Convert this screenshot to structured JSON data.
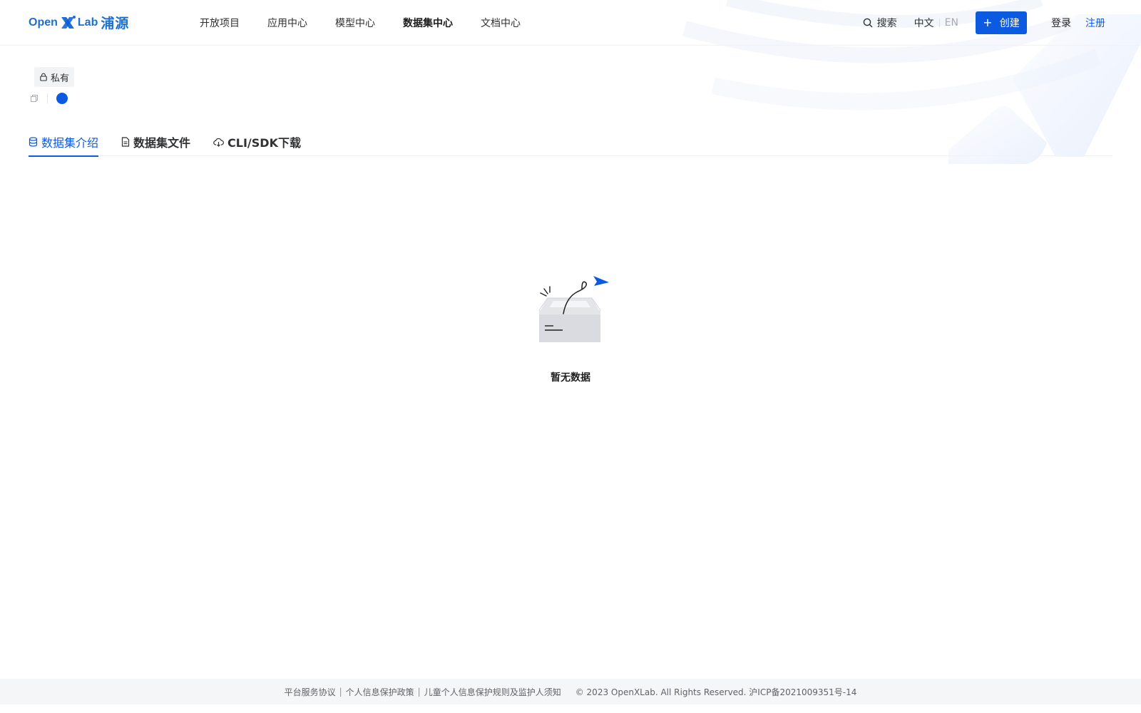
{
  "brand": {
    "logo_open": "Open",
    "logo_lab": "Lab",
    "logo_cn": "浦源",
    "accent": "#0c5ae0"
  },
  "nav": {
    "items": [
      {
        "label": "开放项目"
      },
      {
        "label": "应用中心"
      },
      {
        "label": "模型中心"
      },
      {
        "label": "数据集中心",
        "active": true
      },
      {
        "label": "文档中心"
      }
    ]
  },
  "header": {
    "search_label": "搜索",
    "search_icon": "search-icon",
    "lang_zh": "中文",
    "lang_en": "EN",
    "create_plus": "+",
    "create_label": "创建",
    "login_label": "登录",
    "register_label": "注册"
  },
  "meta": {
    "visibility_label": "私有",
    "visibility_icon": "lock-icon"
  },
  "tabs": [
    {
      "label": "数据集介绍",
      "icon": "database-icon",
      "active": true
    },
    {
      "label": "数据集文件",
      "icon": "file-icon"
    },
    {
      "label": "CLI/SDK下载",
      "icon": "cloud-download-icon"
    }
  ],
  "empty_state": {
    "text": "暂无数据"
  },
  "footer": {
    "links": [
      "平台服务协议",
      "个人信息保护政策",
      "儿童个人信息保护规则及监护人须知"
    ],
    "separator": "|",
    "copyright": "© 2023 OpenXLab. All Rights Reserved. 沪ICP备2021009351号-14"
  }
}
